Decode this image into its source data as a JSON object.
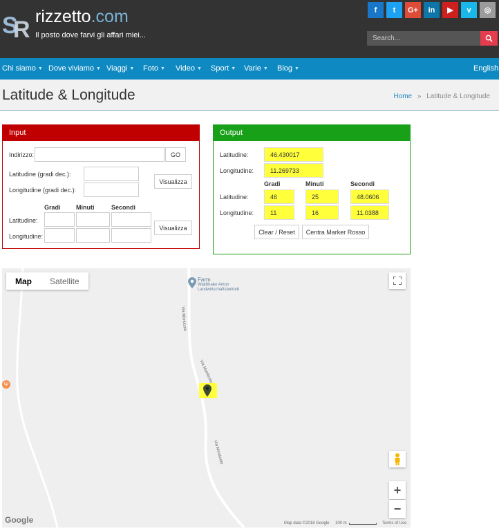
{
  "site": {
    "logo_mark": "SR",
    "name_main": "rizzetto",
    "name_tld": ".com",
    "tagline": "Il posto dove farvi gli affari miei...",
    "search_placeholder": "Search...",
    "socials": [
      {
        "label": "f",
        "icon": "facebook-icon",
        "color": "#1877c9"
      },
      {
        "label": "t",
        "icon": "twitter-icon",
        "color": "#1da1f2"
      },
      {
        "label": "G+",
        "icon": "google-plus-icon",
        "color": "#dd4b39"
      },
      {
        "label": "in",
        "icon": "linkedin-icon",
        "color": "#0e76a8"
      },
      {
        "label": "▶",
        "icon": "youtube-icon",
        "color": "#cd201f"
      },
      {
        "label": "v",
        "icon": "vimeo-icon",
        "color": "#1ab7ea"
      },
      {
        "label": "◎",
        "icon": "instagram-icon",
        "color": "#9b9b9b"
      }
    ]
  },
  "nav": {
    "items": [
      "Chi siamo",
      "Dove viviamo",
      "Viaggi",
      "Foto",
      "Video",
      "Sport",
      "Varie",
      "Blog"
    ],
    "language": "English"
  },
  "page": {
    "title": "Latitude & Longitude",
    "breadcrumb_home": "Home",
    "breadcrumb_sep": "»",
    "breadcrumb_current": "Latitude & Longitude"
  },
  "input_panel": {
    "title": "Input",
    "address_label": "Indirizzo:",
    "address_value": "",
    "go_label": "GO",
    "lat_dec_label": "Latitudine (gradi dec.):",
    "lon_dec_label": "Longitudine (gradi dec.):",
    "visualizza_label": "Visualizza",
    "col_gradi": "Gradi",
    "col_minuti": "Minuti",
    "col_secondi": "Secondi",
    "lat_label": "Latitudine:",
    "lon_label": "Longitudine:"
  },
  "output_panel": {
    "title": "Output",
    "lat_label": "Latitudine:",
    "lon_label": "Longitudine:",
    "lat_dec": "46.430017",
    "lon_dec": "11.269733",
    "col_gradi": "Gradi",
    "col_minuti": "Minuti",
    "col_secondi": "Secondi",
    "lat_gradi": "46",
    "lat_minuti": "25",
    "lat_secondi": "48.0606",
    "lon_gradi": "11",
    "lon_minuti": "16",
    "lon_secondi": "11.0388",
    "clear_label": "Clear / Reset",
    "center_label": "Centra Marker Rosso"
  },
  "map": {
    "tab_map": "Map",
    "tab_satellite": "Satellite",
    "poi_title": "Farm",
    "poi_line1": "Waldthaler Anton",
    "poi_line2": "Landwirtschaftsbetrieb",
    "road_name": "Via Monticolo",
    "google_label": "Google",
    "map_data": "Map data ©2018 Google",
    "scale": "100 m",
    "terms": "Terms of Use",
    "zoom_in": "+",
    "zoom_out": "−"
  },
  "colors": {
    "header_bg": "#333333",
    "nav_bg": "#0e89c2",
    "input_red": "#c00000",
    "output_green": "#18a018",
    "highlight": "#ffff3c"
  }
}
